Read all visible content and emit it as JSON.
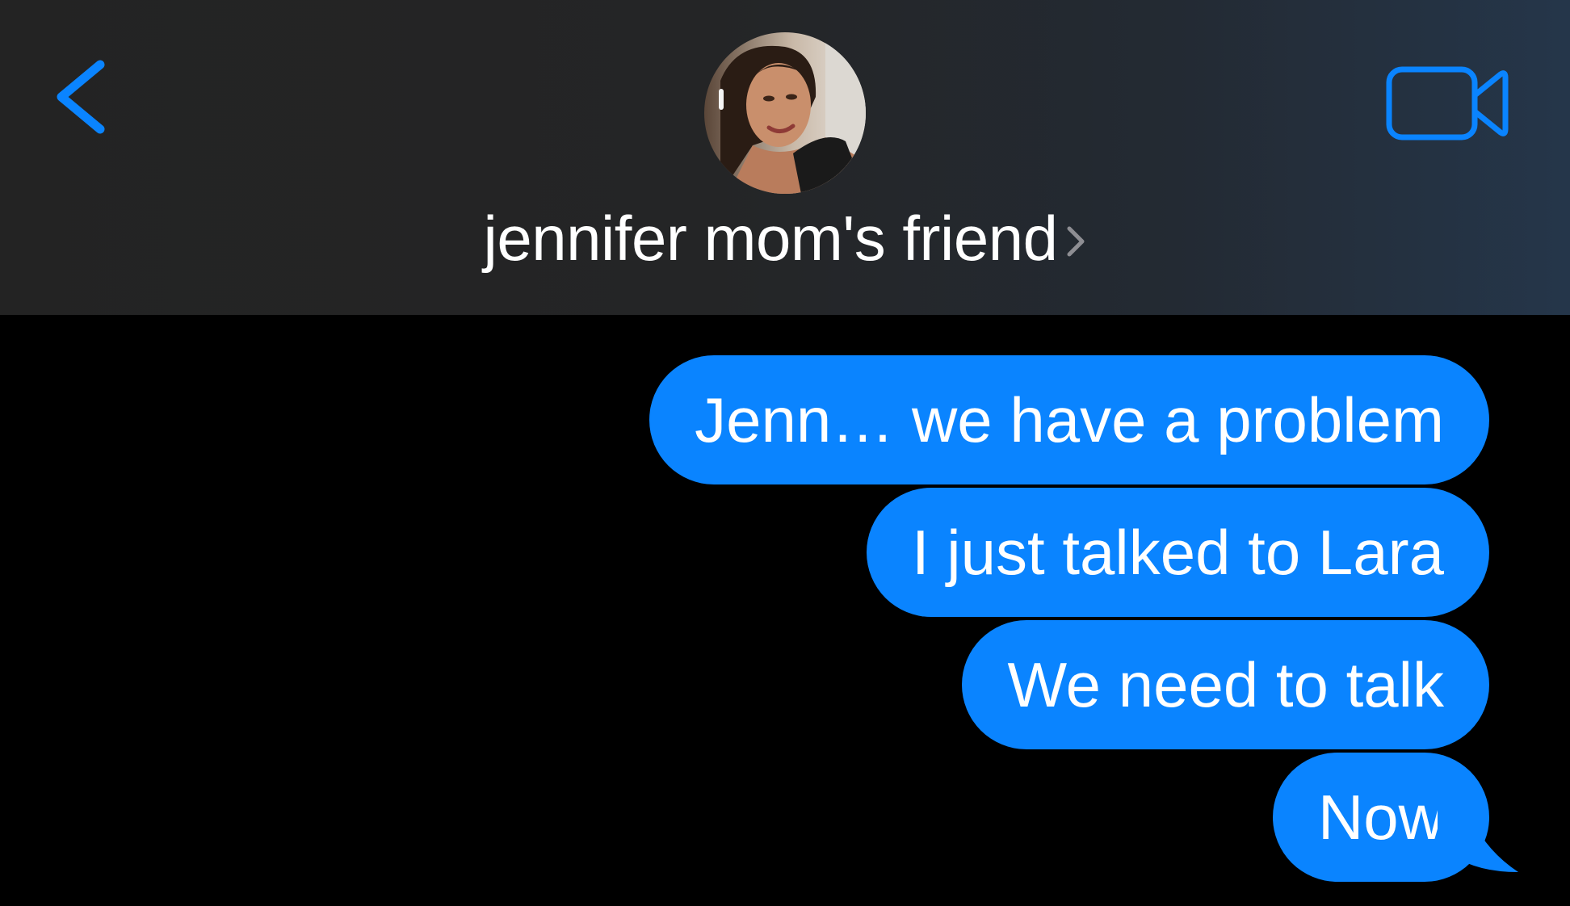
{
  "header": {
    "back_icon": "chevron-left-icon",
    "video_icon": "video-camera-icon",
    "contact_name": "jennifer mom's friend",
    "detail_icon": "chevron-right-icon",
    "accent_color": "#0a84ff"
  },
  "messages": [
    {
      "text": "Jenn… we have a problem",
      "direction": "outgoing"
    },
    {
      "text": "I just talked to Lara",
      "direction": "outgoing"
    },
    {
      "text": "We need to talk",
      "direction": "outgoing"
    },
    {
      "text": "Now",
      "direction": "outgoing"
    }
  ],
  "colors": {
    "bubble_outgoing": "#0a84ff",
    "background": "#000000",
    "header_bg": "#242526"
  }
}
